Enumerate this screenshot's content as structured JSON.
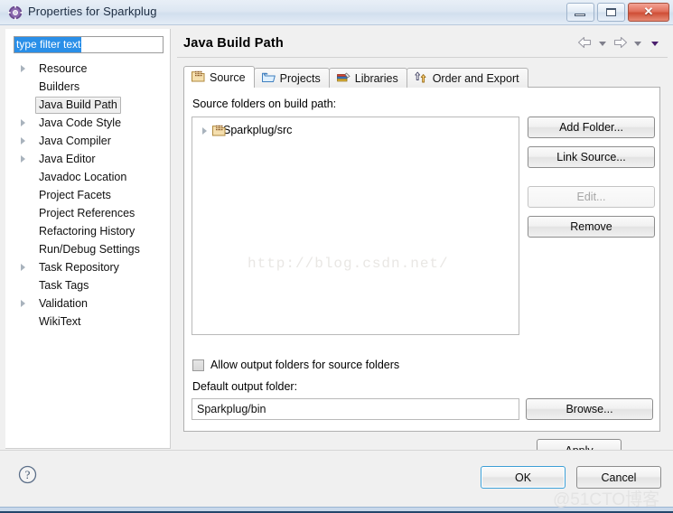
{
  "window": {
    "title": "Properties for Sparkplug",
    "icon": "gear-icon",
    "controls": {
      "minimize": "–",
      "maximize": "□",
      "close": "✕"
    }
  },
  "sidebar": {
    "filter": {
      "value": "type filter text",
      "placeholder": "type filter text"
    },
    "items": [
      {
        "label": "Resource",
        "expandable": true,
        "selected": false
      },
      {
        "label": "Builders",
        "expandable": false,
        "selected": false
      },
      {
        "label": "Java Build Path",
        "expandable": false,
        "selected": true
      },
      {
        "label": "Java Code Style",
        "expandable": true,
        "selected": false
      },
      {
        "label": "Java Compiler",
        "expandable": true,
        "selected": false
      },
      {
        "label": "Java Editor",
        "expandable": true,
        "selected": false
      },
      {
        "label": "Javadoc Location",
        "expandable": false,
        "selected": false
      },
      {
        "label": "Project Facets",
        "expandable": false,
        "selected": false
      },
      {
        "label": "Project References",
        "expandable": false,
        "selected": false
      },
      {
        "label": "Refactoring History",
        "expandable": false,
        "selected": false
      },
      {
        "label": "Run/Debug Settings",
        "expandable": false,
        "selected": false
      },
      {
        "label": "Task Repository",
        "expandable": true,
        "selected": false
      },
      {
        "label": "Task Tags",
        "expandable": false,
        "selected": false
      },
      {
        "label": "Validation",
        "expandable": true,
        "selected": false
      },
      {
        "label": "WikiText",
        "expandable": false,
        "selected": false
      }
    ]
  },
  "page": {
    "title": "Java Build Path",
    "nav": {
      "back": "back-arrow-icon",
      "forward": "forward-arrow-icon"
    }
  },
  "tabs": [
    {
      "label": "Source",
      "icon": "package-folder-icon",
      "active": true
    },
    {
      "label": "Projects",
      "icon": "open-folder-icon",
      "active": false
    },
    {
      "label": "Libraries",
      "icon": "books-icon",
      "active": false
    },
    {
      "label": "Order and Export",
      "icon": "order-arrows-icon",
      "active": false
    }
  ],
  "source_tab": {
    "list_label": "Source folders on build path:",
    "entries": [
      {
        "label": "Sparkplug/src",
        "icon": "package-folder-icon",
        "expandable": true
      }
    ],
    "buttons": [
      {
        "label": "Add Folder...",
        "enabled": true
      },
      {
        "label": "Link Source...",
        "enabled": true
      },
      {
        "label": "Edit...",
        "enabled": false
      },
      {
        "label": "Remove",
        "enabled": true
      }
    ],
    "allow_output_checkbox": {
      "label": "Allow output folders for source folders",
      "checked": false
    },
    "default_output_label": "Default output folder:",
    "default_output_value": "Sparkplug/bin",
    "browse_label": "Browse..."
  },
  "apply_label": "Apply",
  "footer": {
    "help": "help-icon",
    "ok": "OK",
    "cancel": "Cancel"
  },
  "watermarks": {
    "center": "http://blog.csdn.net/",
    "corner": "@51CTO博客"
  }
}
